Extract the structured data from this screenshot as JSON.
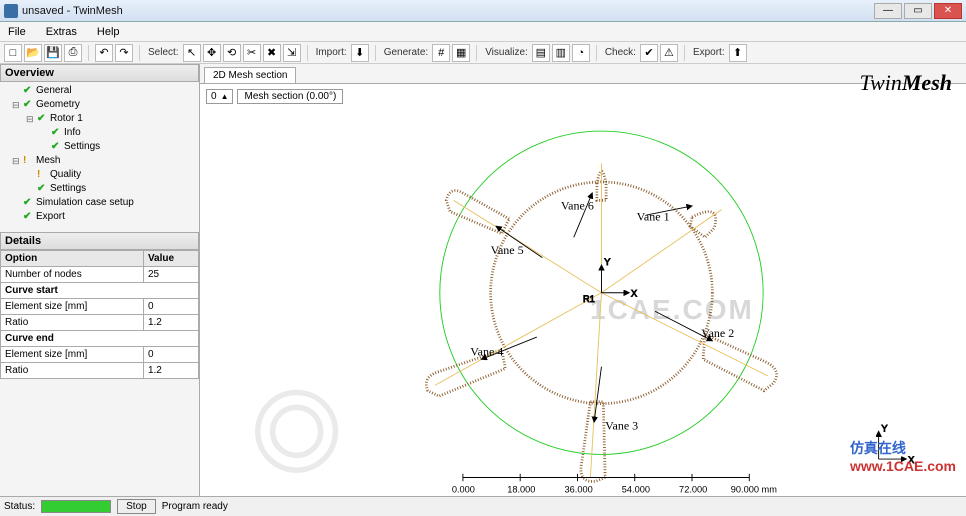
{
  "titlebar": {
    "title": "unsaved - TwinMesh"
  },
  "menubar": {
    "items": [
      "File",
      "Extras",
      "Help"
    ]
  },
  "toolbar": {
    "select_label": "Select:",
    "import_label": "Import:",
    "generate_label": "Generate:",
    "visualize_label": "Visualize:",
    "check_label": "Check:",
    "export_label": "Export:"
  },
  "overview": {
    "title": "Overview",
    "nodes": [
      {
        "indent": 0,
        "status": "check",
        "label": "General"
      },
      {
        "indent": 0,
        "status": "check",
        "label": "Geometry",
        "expander": "-"
      },
      {
        "indent": 1,
        "status": "check",
        "label": "Rotor 1",
        "expander": "+"
      },
      {
        "indent": 2,
        "status": "check",
        "label": "Info"
      },
      {
        "indent": 2,
        "status": "check",
        "label": "Settings"
      },
      {
        "indent": 0,
        "status": "warn",
        "label": "Mesh",
        "expander": "-"
      },
      {
        "indent": 1,
        "status": "warn",
        "label": "Quality"
      },
      {
        "indent": 1,
        "status": "check",
        "label": "Settings"
      },
      {
        "indent": 0,
        "status": "check",
        "label": "Simulation case setup"
      },
      {
        "indent": 0,
        "status": "check",
        "label": "Export"
      }
    ]
  },
  "details": {
    "title": "Details",
    "col_option": "Option",
    "col_value": "Value",
    "rows": [
      {
        "option": "Number of nodes",
        "value": "25"
      }
    ],
    "section1": "Curve start",
    "rows1": [
      {
        "option": "Element size [mm]",
        "value": "0"
      },
      {
        "option": "Ratio",
        "value": "1.2"
      }
    ],
    "section2": "Curve end",
    "rows2": [
      {
        "option": "Element size [mm]",
        "value": "0"
      },
      {
        "option": "Ratio",
        "value": "1.2"
      }
    ]
  },
  "canvas": {
    "tab_label": "2D Mesh section",
    "spinner_value": "0",
    "mesh_section_label": "Mesh section (0.00°)",
    "logo_twin": "Twin",
    "logo_mesh": "Mesh",
    "vanes": [
      "Vane 1",
      "Vane 2",
      "Vane 3",
      "Vane 4",
      "Vane 5",
      "Vane 6"
    ],
    "axis_y": "Y",
    "axis_x": "X",
    "axis_r": "R1",
    "scale_values": [
      "0.000",
      "18.000",
      "36.000",
      "54.000",
      "72.000",
      "90.000 mm"
    ]
  },
  "statusbar": {
    "status_label": "Status:",
    "stop_label": "Stop",
    "ready_label": "Program ready"
  },
  "watermark": {
    "main": "1CAE.COM",
    "asia": "仿真在线",
    "url": "www.1CAE.com"
  }
}
